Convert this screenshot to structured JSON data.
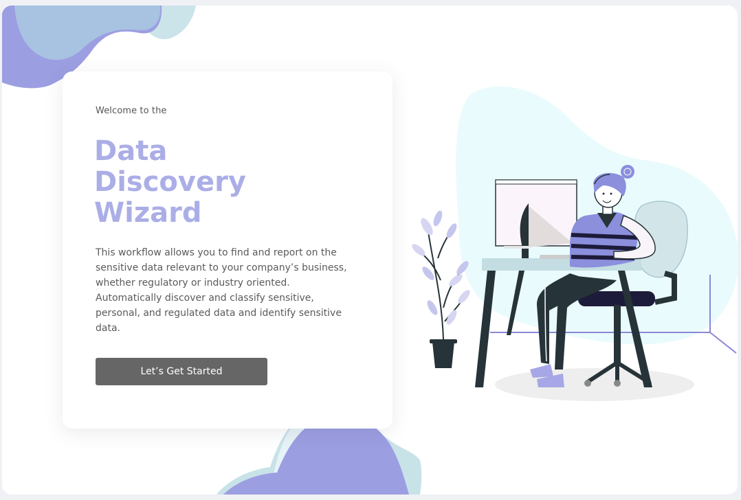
{
  "hero": {
    "welcome": "Welcome to the",
    "title_lines": [
      "Data",
      "Discovery",
      "Wizard"
    ],
    "description": "This workflow allows you to find and report on the sensitive data relevant to your company’s business, whether regulatory or industry oriented. Automatically discover and classify sensitive, personal, and regulated data and identify sensitive data.",
    "cta_label": "Let’s Get Started"
  },
  "colors": {
    "title": "#abaee6",
    "button": "#666666",
    "blob_purple": "#9b9ce0",
    "blob_teal": "#cae4e8",
    "blob_cyan": "#e8fbfd"
  },
  "illustration": {
    "subject": "person-working-at-desk-computer"
  }
}
